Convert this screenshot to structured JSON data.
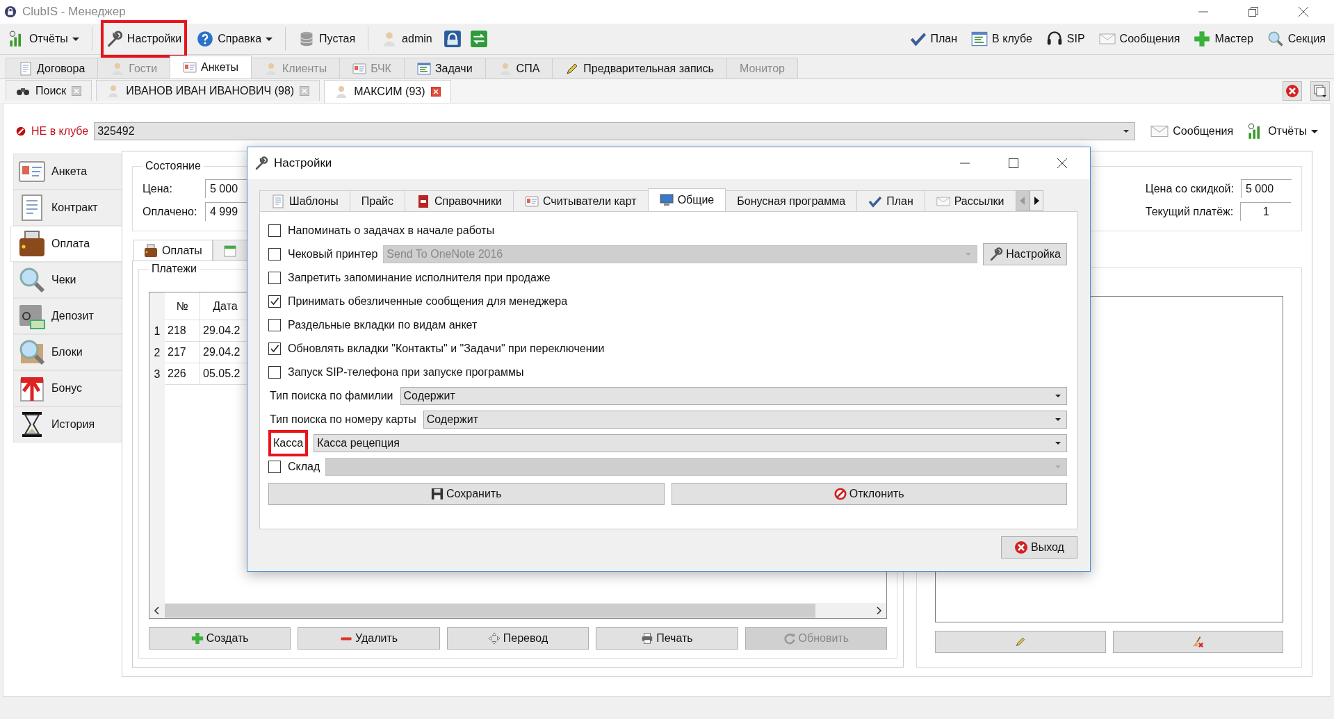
{
  "window": {
    "title": "ClubIS - Менеджер"
  },
  "toolbar": {
    "left": [
      {
        "label": "Отчёты",
        "dropdown": true,
        "highlighted": false
      },
      {
        "label": "Настройки",
        "dropdown": false,
        "highlighted": true
      },
      {
        "label": "Справка",
        "dropdown": true,
        "highlighted": false
      },
      {
        "label": "Пустая",
        "dropdown": false,
        "highlighted": false
      },
      {
        "label": "admin",
        "dropdown": false,
        "highlighted": false
      }
    ],
    "right": [
      "План",
      "В клубе",
      "SIP",
      "Сообщения",
      "Мастер",
      "Секция"
    ]
  },
  "module_tabs": [
    {
      "label": "Договора",
      "selected": false,
      "disabled": false
    },
    {
      "label": "Гости",
      "selected": false,
      "disabled": true
    },
    {
      "label": "Анкеты",
      "selected": true,
      "disabled": false
    },
    {
      "label": "Клиенты",
      "selected": false,
      "disabled": true
    },
    {
      "label": "БЧК",
      "selected": false,
      "disabled": true
    },
    {
      "label": "Задачи",
      "selected": false,
      "disabled": false
    },
    {
      "label": "СПА",
      "selected": false,
      "disabled": false
    },
    {
      "label": "Предварительная запись",
      "selected": false,
      "disabled": false
    },
    {
      "label": "Монитор",
      "selected": false,
      "disabled": true
    }
  ],
  "document_tabs": [
    {
      "label": "Поиск",
      "selected": false
    },
    {
      "label": "ИВАНОВ ИВАН ИВАНОВИЧ (98)",
      "selected": false
    },
    {
      "label": "МАКСИМ  (93)",
      "selected": true
    }
  ],
  "client_bar": {
    "status": "НЕ в клубе",
    "card": "325492",
    "buttons": [
      "Сообщения",
      "Отчёты"
    ]
  },
  "sidebar": {
    "items": [
      {
        "label": "Анкета",
        "selected": false
      },
      {
        "label": "Контракт",
        "selected": false
      },
      {
        "label": "Оплата",
        "selected": true
      },
      {
        "label": "Чеки",
        "selected": false
      },
      {
        "label": "Депозит",
        "selected": false
      },
      {
        "label": "Блоки",
        "selected": false
      },
      {
        "label": "Бонус",
        "selected": false
      },
      {
        "label": "История",
        "selected": false
      }
    ]
  },
  "state_group": {
    "title": "Состояние",
    "fields": [
      {
        "label": "Цена:",
        "value": "5 000"
      },
      {
        "label": "Оплачено:",
        "value": "4 999"
      }
    ],
    "right_fields": [
      {
        "label": "Цена со скидкой:",
        "value": "5 000"
      },
      {
        "label": "Текущий платёж:",
        "value": "1"
      }
    ]
  },
  "payment_tabs": [
    {
      "label": "Оплаты",
      "selected": true
    },
    {
      "selected": false
    }
  ],
  "payments": {
    "title": "Платежи",
    "columns": [
      "№",
      "Дата"
    ],
    "rows": [
      {
        "index": "1",
        "cells": [
          "218",
          "29.04.2"
        ]
      },
      {
        "index": "2",
        "cells": [
          "217",
          "29.04.2"
        ]
      },
      {
        "index": "3",
        "cells": [
          "226",
          "05.05.2"
        ]
      }
    ],
    "buttons": [
      {
        "label": "Создать",
        "disabled": false
      },
      {
        "label": "Удалить",
        "disabled": false
      },
      {
        "label": "Перевод",
        "disabled": false
      },
      {
        "label": "Печать",
        "disabled": false
      },
      {
        "label": "Обновить",
        "disabled": true
      }
    ]
  },
  "dialog": {
    "title": "Настройки",
    "tabs": [
      {
        "label": "Шаблоны",
        "selected": false
      },
      {
        "label": "Прайс",
        "selected": false
      },
      {
        "label": "Справочники",
        "selected": false
      },
      {
        "label": "Считыватели карт",
        "selected": false
      },
      {
        "label": "Общие",
        "selected": true
      },
      {
        "label": "Бонусная программа",
        "selected": false
      },
      {
        "label": "План",
        "selected": false
      },
      {
        "label": "Рассылки",
        "selected": false
      }
    ],
    "options": [
      {
        "kind": "checkbox",
        "label": "Напоминать о задачах в начале работы",
        "checked": false
      },
      {
        "kind": "checkbox_combo",
        "label": "Чековый принтер",
        "checked": false,
        "value": "Send To OneNote 2016",
        "disabled": true,
        "button": "Настройка"
      },
      {
        "kind": "checkbox",
        "label": "Запретить запоминание исполнителя при продаже",
        "checked": false
      },
      {
        "kind": "checkbox",
        "label": "Принимать обезличенные сообщения для менеджера",
        "checked": true
      },
      {
        "kind": "checkbox",
        "label": "Раздельные вкладки по видам анкет",
        "checked": false
      },
      {
        "kind": "checkbox",
        "label": "Обновлять вкладки \"Контакты\" и \"Задачи\" при переключении",
        "checked": true
      },
      {
        "kind": "checkbox",
        "label": "Запуск SIP-телефона при запуске программы",
        "checked": false
      },
      {
        "kind": "combo",
        "label": "Тип поиска по фамилии",
        "value": "Содержит",
        "highlighted": false
      },
      {
        "kind": "combo",
        "label": "Тип поиска по номеру карты",
        "value": "Содержит",
        "highlighted": false
      },
      {
        "kind": "combo",
        "label": "Касса",
        "value": "Касса рецепция",
        "highlighted": true
      },
      {
        "kind": "checkbox_combo",
        "label": "Склад",
        "checked": false,
        "disabled": true
      }
    ],
    "buttons": [
      "Сохранить",
      "Отклонить"
    ],
    "exit": "Выход"
  }
}
